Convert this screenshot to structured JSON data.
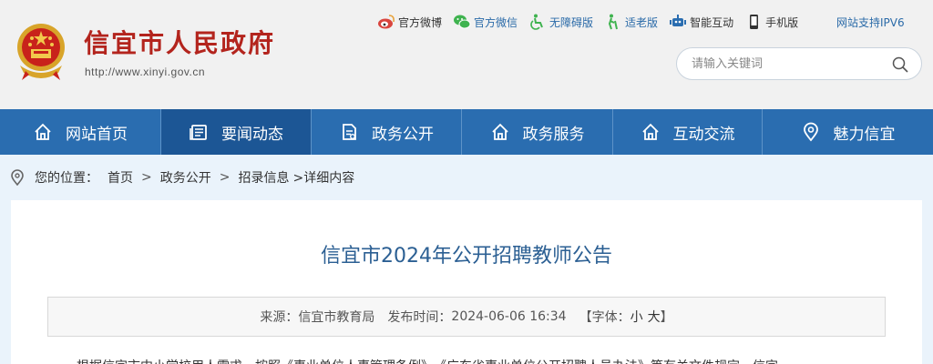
{
  "site": {
    "title": "信宜市人民政府",
    "url": "http://www.xinyi.gov.cn"
  },
  "toplinks": [
    {
      "label": "官方微博",
      "icon": "weibo-icon"
    },
    {
      "label": "官方微信",
      "icon": "wechat-icon"
    },
    {
      "label": "无障碍版",
      "icon": "accessibility-icon"
    },
    {
      "label": "适老版",
      "icon": "elderly-icon"
    },
    {
      "label": "智能互动",
      "icon": "robot-icon"
    },
    {
      "label": "手机版",
      "icon": "mobile-icon"
    }
  ],
  "ipv6": "网站支持IPV6",
  "search": {
    "placeholder": "请输入关键词"
  },
  "nav": [
    {
      "label": "网站首页",
      "icon": "home-icon"
    },
    {
      "label": "要闻动态",
      "icon": "news-icon"
    },
    {
      "label": "政务公开",
      "icon": "document-icon"
    },
    {
      "label": "政务服务",
      "icon": "home-icon"
    },
    {
      "label": "互动交流",
      "icon": "home-icon"
    },
    {
      "label": "魅力信宜",
      "icon": "location-icon"
    }
  ],
  "breadcrumb": {
    "prefix": "您的位置：",
    "items": [
      "首页",
      "政务公开",
      "招录信息"
    ],
    "current": ">详细内容",
    "separator": ">"
  },
  "article": {
    "title": "信宜市2024年公开招聘教师公告",
    "source_label": "来源：",
    "source": "信宜市教育局",
    "time_label": "发布时间：",
    "time": "2024-06-06 16:34",
    "font_label": "【字体：",
    "font_small": "小",
    "font_large": "大",
    "font_close": "】",
    "first_line": "根据信宜市中小学校用人需求，按照《事业单位人事管理条例》、《广东省事业单位公开招聘人员办法》等有关文件规定，信宜"
  },
  "colors": {
    "brand_red": "#b3241d",
    "nav_blue": "#2a6db0",
    "nav_active": "#1c5695",
    "title_blue": "#2b5f93"
  }
}
